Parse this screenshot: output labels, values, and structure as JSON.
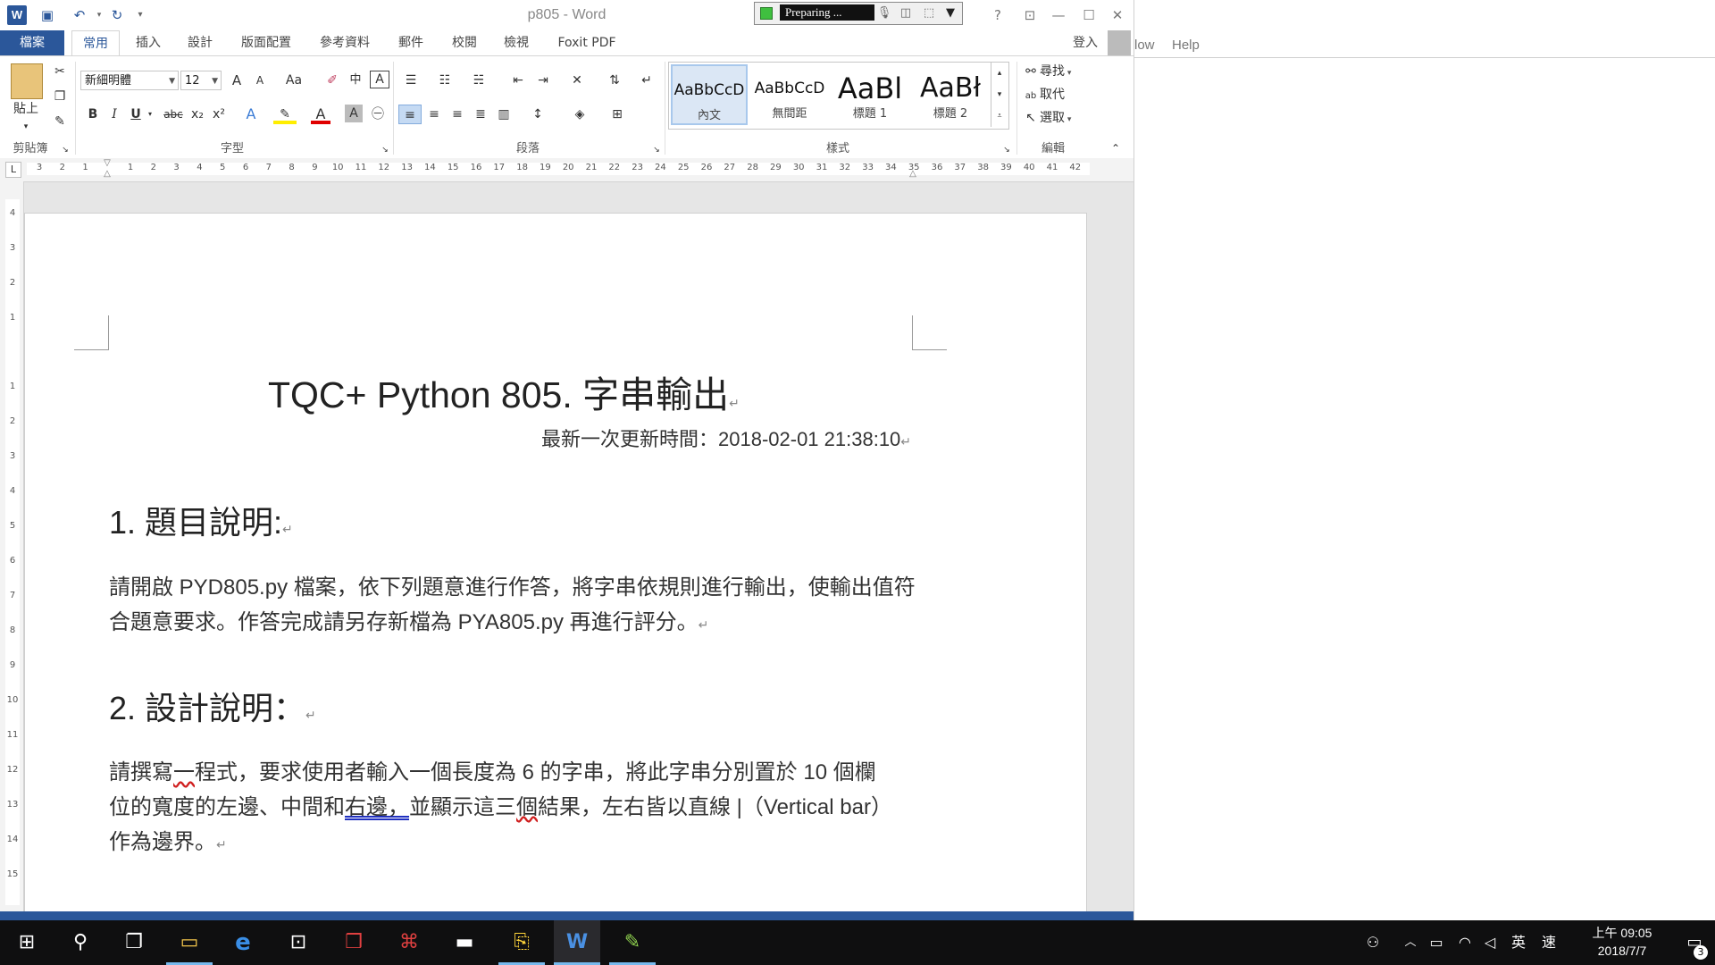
{
  "window": {
    "title": "p805 - Word"
  },
  "recorder": {
    "status": "Preparing ..."
  },
  "titlebar": {
    "icons": [
      "word-logo-icon",
      "save-icon",
      "undo-icon",
      "redo-icon",
      "customize-icon"
    ],
    "help": "?",
    "ribbon_display": "⊡",
    "minimize": "—",
    "maximize": "☐",
    "close": "✕"
  },
  "tabs": [
    {
      "id": "file",
      "label": "檔案"
    },
    {
      "id": "home",
      "label": "常用"
    },
    {
      "id": "insert",
      "label": "插入"
    },
    {
      "id": "design",
      "label": "設計"
    },
    {
      "id": "layout",
      "label": "版面配置"
    },
    {
      "id": "references",
      "label": "參考資料"
    },
    {
      "id": "mailings",
      "label": "郵件"
    },
    {
      "id": "review",
      "label": "校閱"
    },
    {
      "id": "view",
      "label": "檢視"
    },
    {
      "id": "foxit",
      "label": "Foxit PDF"
    }
  ],
  "signin": "登入",
  "ribbon": {
    "clipboard": {
      "paste": "貼上",
      "label": "剪貼簿"
    },
    "font": {
      "name": "新細明體",
      "size": "12",
      "label": "字型",
      "case": "Aa",
      "grow": "A",
      "shrink": "A",
      "bold": "B",
      "italic": "I",
      "underline": "U",
      "strike": "abc",
      "sub": "x₂",
      "sup": "x²",
      "clear": "A"
    },
    "paragraph": {
      "label": "段落"
    },
    "styles": {
      "label": "樣式",
      "items": [
        {
          "sample": "AaBbCcD",
          "name": "內文"
        },
        {
          "sample": "AaBbCcD",
          "name": "無間距"
        },
        {
          "sample": "AaBl",
          "name": "標題 1"
        },
        {
          "sample": "AaBł",
          "name": "標題 2"
        }
      ]
    },
    "editing": {
      "label": "編輯",
      "find": "尋找",
      "replace": "取代",
      "select": "選取"
    }
  },
  "ruler": {
    "corner": "L",
    "left_ticks": [
      "3",
      "2",
      "1"
    ],
    "ticks": [
      "1",
      "2",
      "3",
      "4",
      "5",
      "6",
      "7",
      "8",
      "9",
      "10",
      "11",
      "12",
      "13",
      "14",
      "15",
      "16",
      "17",
      "18",
      "19",
      "20",
      "21",
      "22",
      "23",
      "24",
      "25",
      "26",
      "27",
      "28",
      "29",
      "30",
      "31",
      "32",
      "33",
      "34",
      "35",
      "36",
      "37",
      "38",
      "39",
      "40",
      "41",
      "42"
    ],
    "vertical_top": [
      "4",
      "3",
      "2",
      "1"
    ],
    "vertical": [
      "1",
      "2",
      "3",
      "4",
      "5",
      "6",
      "7",
      "8",
      "9",
      "10",
      "11",
      "12",
      "13",
      "14",
      "15"
    ]
  },
  "document": {
    "title": "TQC+ Python 805.  字串輸出",
    "updated": "最新一次更新時間：2018-02-01 21:38:10",
    "section1": {
      "heading": "1.  題目說明:",
      "body": "請開啟 PYD805.py 檔案，依下列題意進行作答，將字串依規則進行輸出，使輸出值符合題意要求。作答完成請另存新檔為 PYA805.py 再進行評分。"
    },
    "section2": {
      "heading": "2.  設計說明：",
      "body_parts": [
        "請撰寫",
        "一",
        "程式，要求使用者輸入一個長度為 6 的字串，將此字串分別置於 10 個欄位的寬度的左邊、中間和",
        "右邊，",
        "並顯示這三",
        "個",
        "結果，左右皆以直線 |（Vertical bar）作為邊界。"
      ]
    },
    "paragraph_mark": "↵"
  },
  "right_window": {
    "menu": [
      "low",
      "Help"
    ]
  },
  "taskbar": {
    "apps": [
      {
        "name": "start",
        "icon": "⊞"
      },
      {
        "name": "search",
        "icon": "⚲"
      },
      {
        "name": "task-view",
        "icon": "❐"
      },
      {
        "name": "file-explorer",
        "icon": "▭"
      },
      {
        "name": "edge",
        "icon": "e"
      },
      {
        "name": "store",
        "icon": "⊡"
      },
      {
        "name": "gift",
        "icon": "❒"
      },
      {
        "name": "acrobat",
        "icon": "⌘"
      },
      {
        "name": "terminal",
        "icon": "▬"
      },
      {
        "name": "python",
        "icon": "⎘"
      },
      {
        "name": "word",
        "icon": "W"
      },
      {
        "name": "notepadpp",
        "icon": "✎"
      }
    ],
    "tray": {
      "ime_lang": "英",
      "ime_mode": "速"
    },
    "clock": {
      "time": "上午 09:05",
      "date": "2018/7/7"
    },
    "notifications": "3"
  },
  "colors": {
    "word_blue": "#2b579a",
    "taskbar": "#0f0f10"
  }
}
